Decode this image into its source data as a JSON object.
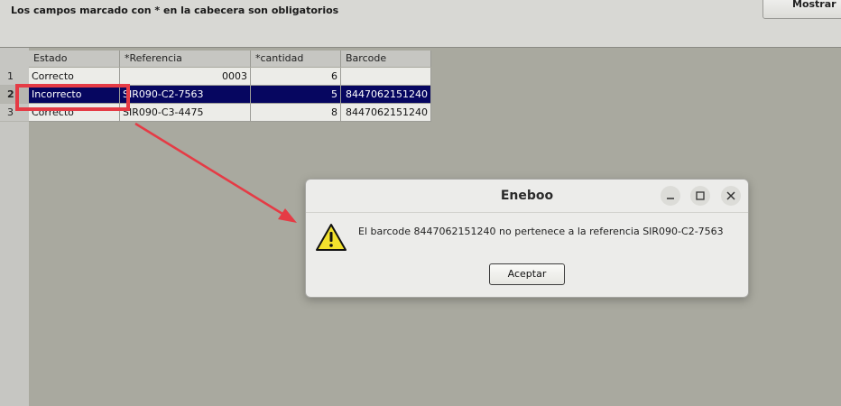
{
  "header": {
    "note": "Los campos marcado con * en la cabecera son obligatorios",
    "top_button_label": "Mostrar"
  },
  "table": {
    "columns": [
      "Estado",
      "*Referencia",
      "*cantidad",
      "Barcode"
    ],
    "rows": [
      {
        "num": "1",
        "estado": "Correcto",
        "referencia": "0003",
        "cantidad": "6",
        "barcode": ""
      },
      {
        "num": "2",
        "estado": "Incorrecto",
        "referencia": "SIR090-C2-7563",
        "cantidad": "5",
        "barcode": "8447062151240"
      },
      {
        "num": "3",
        "estado": "Correcto",
        "referencia": "SIR090-C3-4475",
        "cantidad": "8",
        "barcode": "8447062151240"
      }
    ],
    "selected_row": 2
  },
  "dialog": {
    "title": "Eneboo",
    "message": "El barcode 8447062151240 no pertenece a la referencia SIR090-C2-7563",
    "accept_label": "Aceptar",
    "icon": "warning-icon",
    "window_buttons": [
      "minimize-icon",
      "maximize-icon",
      "close-icon"
    ]
  },
  "colors": {
    "selection": "#060660",
    "annotation": "#e53b45",
    "grid_background": "#a9a99f"
  }
}
